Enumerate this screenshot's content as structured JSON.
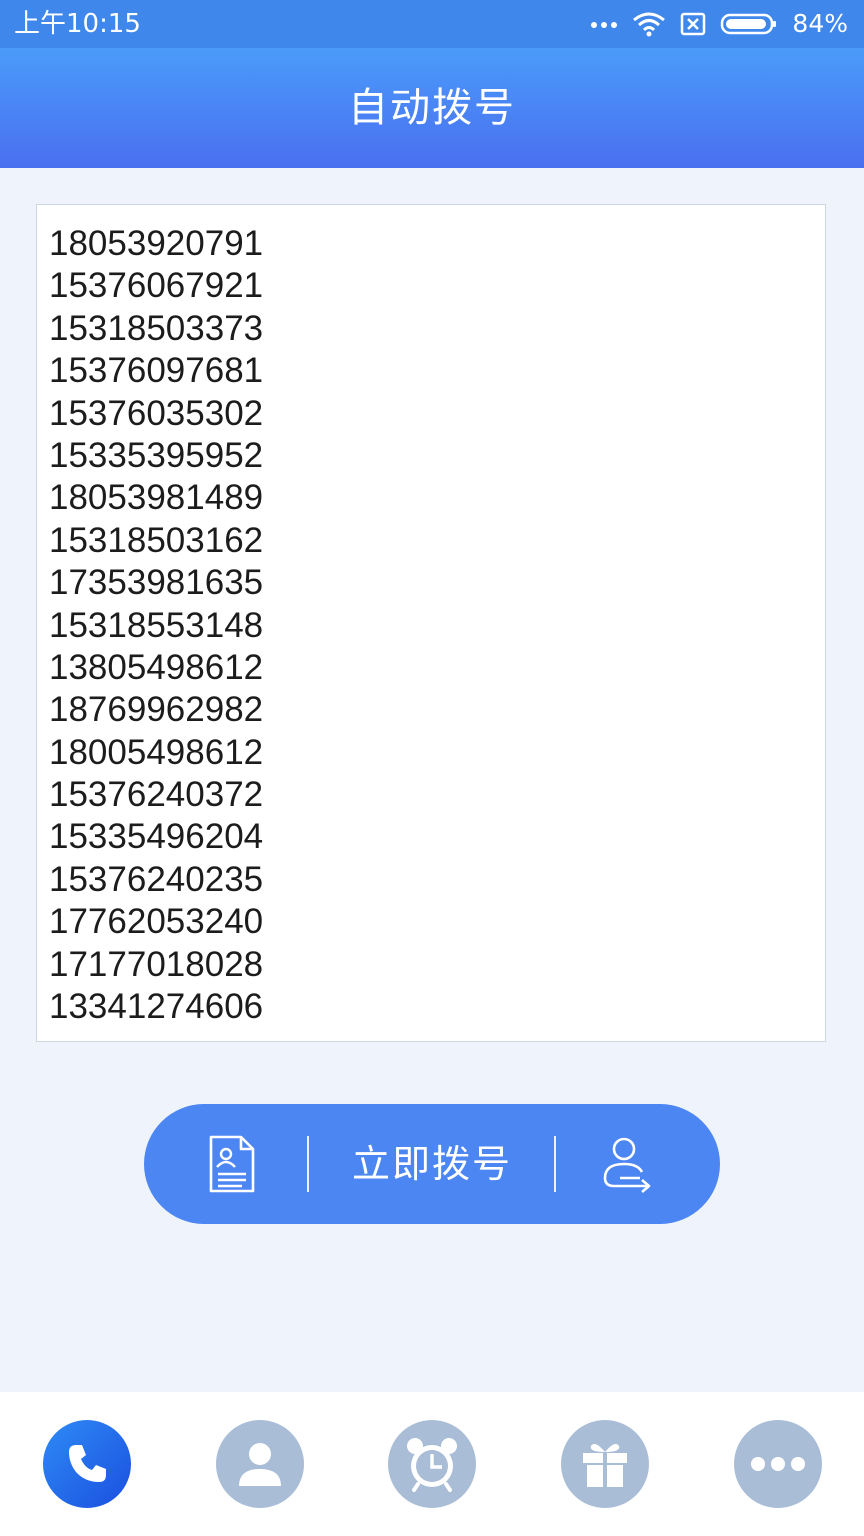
{
  "status_bar": {
    "time": "上午10:15",
    "battery": "84%",
    "icons": [
      "more-dots-icon",
      "wifi-icon",
      "sim-off-icon",
      "battery-icon"
    ]
  },
  "header": {
    "title": "自动拨号"
  },
  "numbers": [
    "18053920791",
    "15376067921",
    "15318503373",
    "15376097681",
    "15376035302",
    "15335395952",
    "18053981489",
    "15318503162",
    "17353981635",
    "15318553148",
    "13805498612",
    "18769962982",
    "18005498612",
    "15376240372",
    "15335496204",
    "15376240235",
    "17762053240",
    "17177018028",
    "13341274606"
  ],
  "action_bar": {
    "dial_label": "立即拨号",
    "left_icon": "contact-document-icon",
    "right_icon": "user-switch-icon"
  },
  "bottom_nav": {
    "items": [
      {
        "icon": "phone-icon",
        "active": true
      },
      {
        "icon": "contact-icon",
        "active": false
      },
      {
        "icon": "alarm-clock-icon",
        "active": false
      },
      {
        "icon": "gift-icon",
        "active": false
      },
      {
        "icon": "more-icon",
        "active": false
      }
    ]
  },
  "colors": {
    "status_bar": "#3f87ea",
    "header_top": "#4a9bfa",
    "header_bottom": "#4a6ff0",
    "page_background": "#eff4fc",
    "action_pill": "#4c86f2",
    "nav_inactive": "#a9bdd6",
    "nav_active": "#1a4fe0"
  }
}
